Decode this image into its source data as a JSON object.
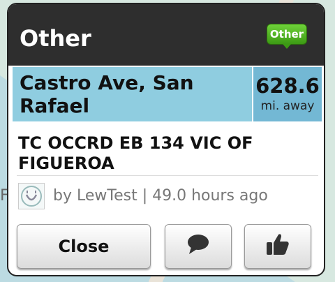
{
  "background": {
    "map_label": "F"
  },
  "dialog": {
    "title": "Other",
    "category_badge": "Other",
    "location": "Castro Ave, San Rafael",
    "distance_value": "628.6",
    "distance_unit": "mi. away",
    "description": "TC OCCRD EB 134 VIC OF FIGUEROA",
    "byline": "by LewTest | 49.0 hours ago",
    "buttons": {
      "close_label": "Close"
    }
  },
  "icons": {
    "avatar": "smiley-avatar-icon",
    "comment": "speech-bubble-icon",
    "like": "thumbs-up-icon"
  },
  "colors": {
    "header_bg": "#2e2e2e",
    "location_bg": "#8fcde0",
    "distance_bg": "#73b8d4",
    "badge_green": "#4caf1f"
  }
}
